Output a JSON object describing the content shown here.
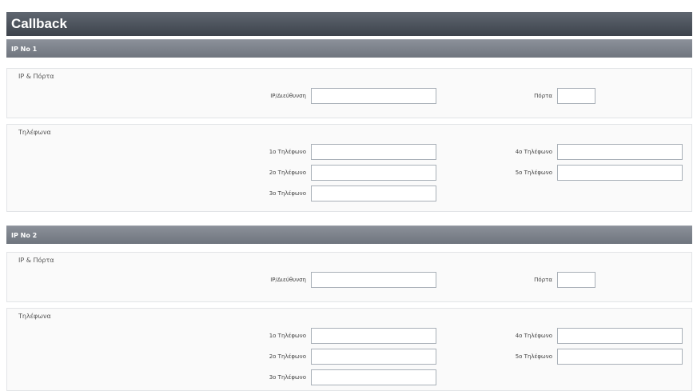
{
  "page": {
    "title": "Callback"
  },
  "sections": [
    {
      "header": "IP No 1",
      "ip_group": {
        "label": "IP & Πόρτα",
        "ip_label": "IP/Διεύθυνση",
        "ip_value": "",
        "port_label": "Πόρτα",
        "port_value": ""
      },
      "phone_group": {
        "label": "Τηλέφωνα",
        "phones": [
          {
            "label": "1ο Τηλέφωνο",
            "value": ""
          },
          {
            "label": "2ο Τηλέφωνο",
            "value": ""
          },
          {
            "label": "3ο Τηλέφωνο",
            "value": ""
          },
          {
            "label": "4ο Τηλέφωνο",
            "value": ""
          },
          {
            "label": "5ο Τηλέφωνο",
            "value": ""
          }
        ]
      }
    },
    {
      "header": "IP No 2",
      "ip_group": {
        "label": "IP & Πόρτα",
        "ip_label": "IP/Διεύθυνση",
        "ip_value": "",
        "port_label": "Πόρτα",
        "port_value": ""
      },
      "phone_group": {
        "label": "Τηλέφωνα",
        "phones": [
          {
            "label": "1ο Τηλέφωνο",
            "value": ""
          },
          {
            "label": "2ο Τηλέφωνο",
            "value": ""
          },
          {
            "label": "3ο Τηλέφωνο",
            "value": ""
          },
          {
            "label": "4ο Τηλέφωνο",
            "value": ""
          },
          {
            "label": "5ο Τηλέφωνο",
            "value": ""
          }
        ]
      }
    }
  ]
}
